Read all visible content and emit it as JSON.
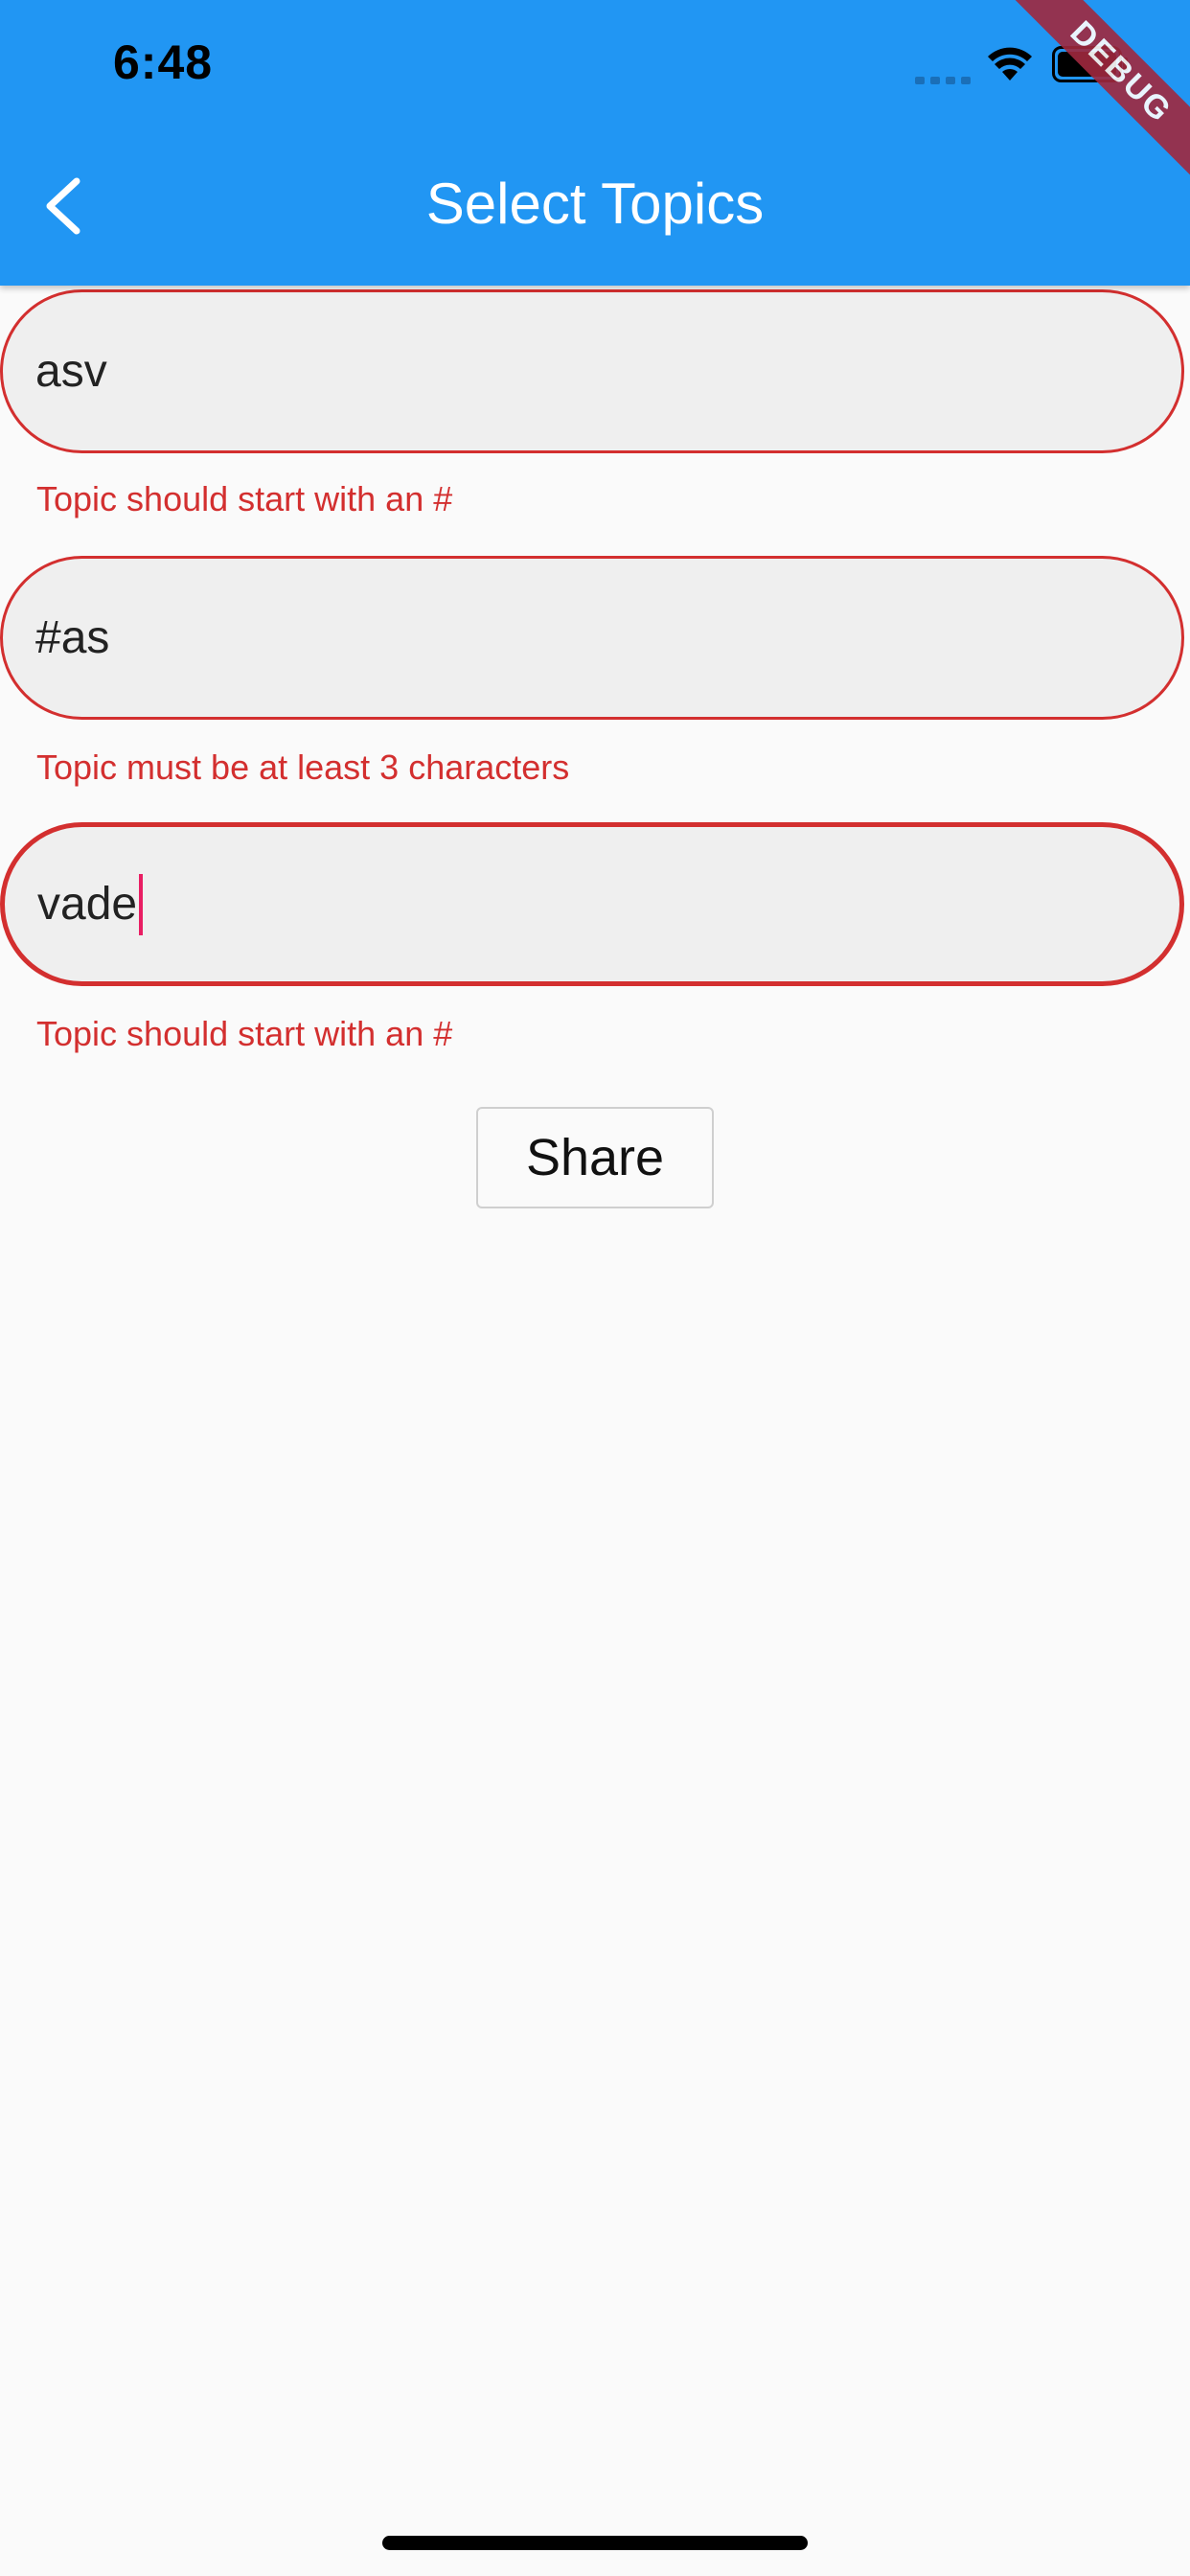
{
  "status_bar": {
    "time": "6:48"
  },
  "app_bar": {
    "title": "Select Topics",
    "back_icon": "chevron-left-icon",
    "color": "#2196f3"
  },
  "debug_banner": {
    "label": "DEBUG"
  },
  "fields": [
    {
      "value": "asv",
      "error": "Topic should start with an #",
      "focused": false
    },
    {
      "value": "#as",
      "error": "Topic must be at least 3 characters",
      "focused": false
    },
    {
      "value": "vade",
      "error": "Topic should start with an #",
      "focused": true
    }
  ],
  "share_button": {
    "label": "Share"
  },
  "colors": {
    "error": "#d32f2f",
    "caret": "#e91e63",
    "field_fill": "#efefef"
  }
}
